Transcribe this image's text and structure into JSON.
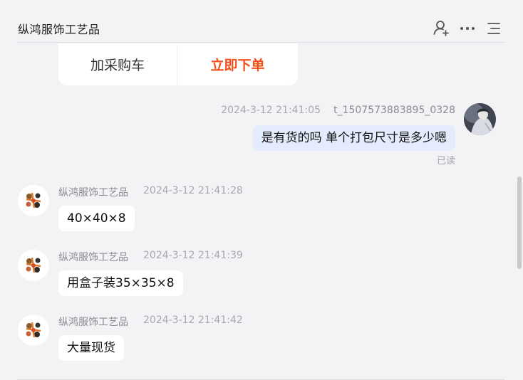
{
  "header": {
    "title": "纵鸿服饰工艺品",
    "icons": [
      "user-add-icon",
      "more-icon",
      "list-icon"
    ]
  },
  "order_card": {
    "cart_label": "加采购车",
    "buy_label": "立即下单",
    "buy_color": "#f2501b"
  },
  "messages": [
    {
      "side": "right",
      "time": "2024-3-12 21:41:05",
      "sender": "t_1507573883895_0328",
      "text": "是有货的吗 单个打包尺寸是多少嗯",
      "status": "已读"
    },
    {
      "side": "left",
      "sender": "纵鸿服饰工艺品",
      "time": "2024-3-12 21:41:28",
      "text": "40×40×8"
    },
    {
      "side": "left",
      "sender": "纵鸿服饰工艺品",
      "time": "2024-3-12 21:41:39",
      "text": "用盒子装35×35×8"
    },
    {
      "side": "left",
      "sender": "纵鸿服饰工艺品",
      "time": "2024-3-12 21:41:42",
      "text": "大量现货"
    }
  ],
  "colors": {
    "background": "#f3f3f5",
    "my_bubble": "#e4ebfd",
    "their_bubble": "#ffffff"
  }
}
